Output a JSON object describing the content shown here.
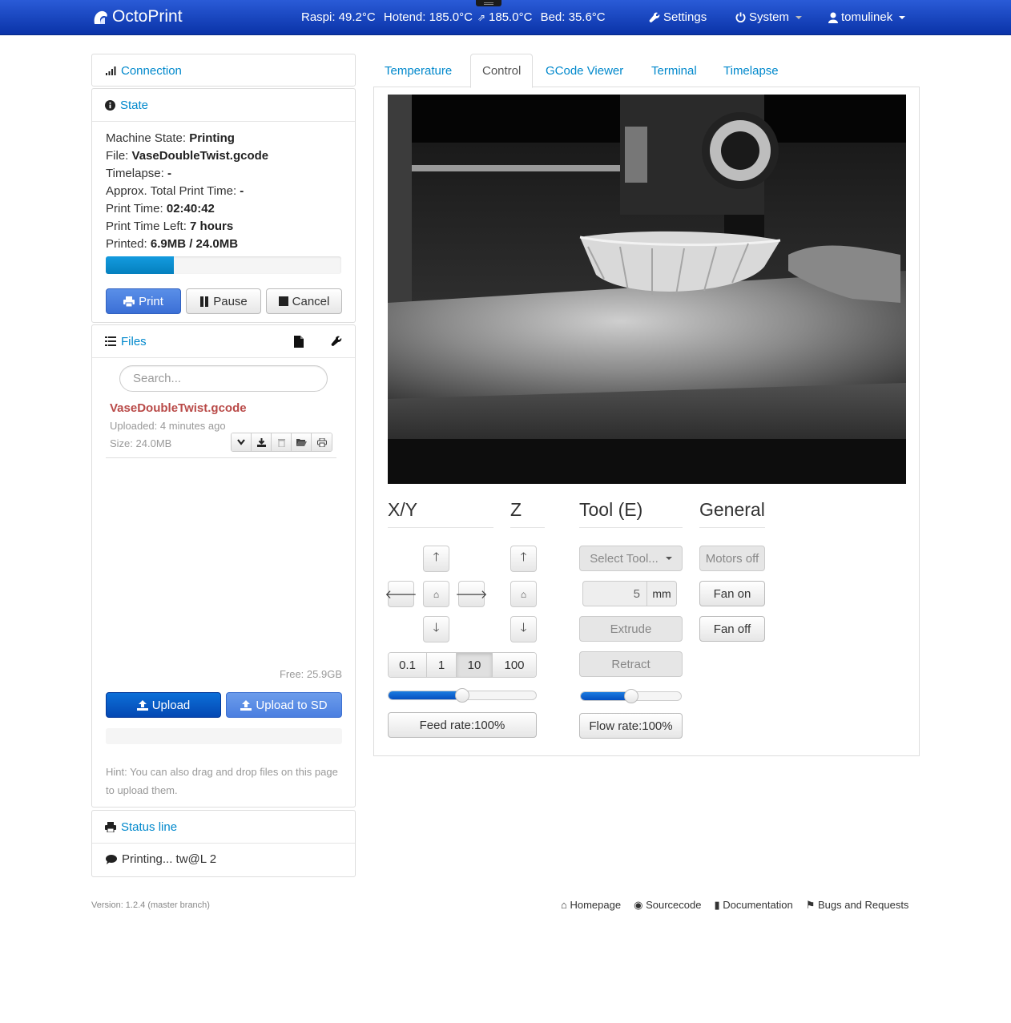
{
  "navbar": {
    "brand": "OctoPrint",
    "temps": {
      "raspi": "Raspi: 49.2°C",
      "hotend": "Hotend: 185.0°C",
      "target": "185.0°C",
      "bed": "Bed: 35.6°C"
    },
    "settings": "Settings",
    "system": "System",
    "user": "tomulinek"
  },
  "sidebar": {
    "connection": {
      "title": "Connection"
    },
    "state": {
      "title": "State",
      "machine_state_label": "Machine State:",
      "machine_state": "Printing",
      "file_label": "File:",
      "file": "VaseDoubleTwist.gcode",
      "timelapse_label": "Timelapse:",
      "timelapse": "-",
      "approx_label": "Approx. Total Print Time:",
      "approx": "-",
      "print_time_label": "Print Time:",
      "print_time": "02:40:42",
      "time_left_label": "Print Time Left:",
      "time_left": "7 hours",
      "printed_label": "Printed:",
      "printed": "6.9MB / 24.0MB",
      "progress": 0.2875,
      "print_btn": "Print",
      "pause_btn": "Pause",
      "cancel_btn": "Cancel"
    },
    "files": {
      "title": "Files",
      "search_placeholder": "Search...",
      "items": [
        {
          "name": "VaseDoubleTwist.gcode",
          "uploaded": "Uploaded: 4 minutes ago",
          "size": "Size: 24.0MB"
        }
      ],
      "free": "Free: 25.9GB",
      "upload_btn": "Upload",
      "upload_sd_btn": "Upload to SD",
      "hint": "Hint: You can also drag and drop files on this page to upload them."
    },
    "status_line": {
      "title": "Status line",
      "text": "Printing... tw@L 2"
    }
  },
  "tabs": [
    "Temperature",
    "Control",
    "GCode Viewer",
    "Terminal",
    "Timelapse"
  ],
  "active_tab": "Control",
  "control": {
    "xy_title": "X/Y",
    "z_title": "Z",
    "tool_title": "Tool (E)",
    "general_title": "General",
    "steps": [
      "0.1",
      "1",
      "10",
      "100"
    ],
    "active_step": "10",
    "feed_rate_btn": "Feed rate:100%",
    "feed_rate": 0.5,
    "select_tool": "Select Tool...",
    "extrude_amount": "5",
    "extrude_unit": "mm",
    "extrude_btn": "Extrude",
    "retract_btn": "Retract",
    "flow_rate_btn": "Flow rate:100%",
    "flow_rate": 0.5,
    "motors_off_btn": "Motors off",
    "fan_on_btn": "Fan on",
    "fan_off_btn": "Fan off"
  },
  "footer": {
    "version": "Version: 1.2.4 (master branch)",
    "links": [
      "Homepage",
      "Sourcecode",
      "Documentation",
      "Bugs and Requests"
    ]
  }
}
